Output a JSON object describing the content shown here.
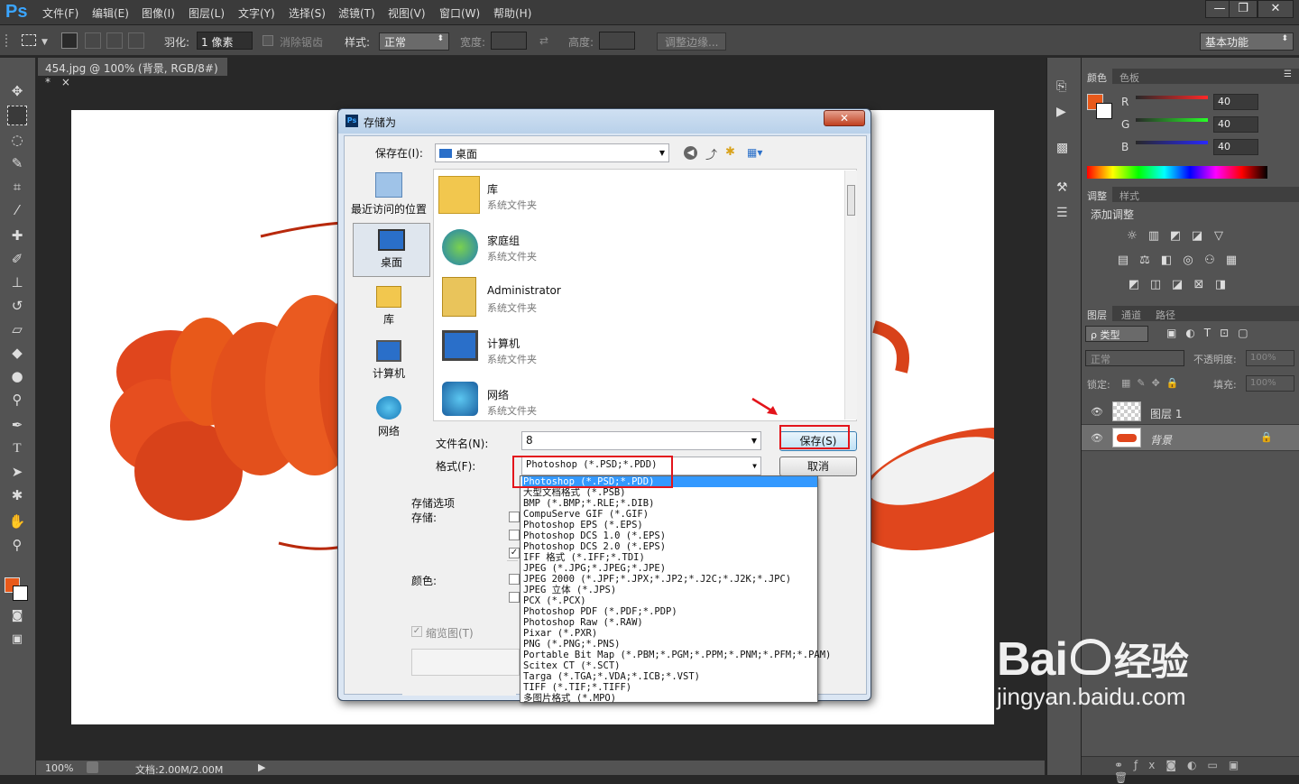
{
  "app": {
    "logo": "Ps"
  },
  "menu": [
    "文件(F)",
    "编辑(E)",
    "图像(I)",
    "图层(L)",
    "文字(Y)",
    "选择(S)",
    "滤镜(T)",
    "视图(V)",
    "窗口(W)",
    "帮助(H)"
  ],
  "window_controls": {
    "min": "—",
    "restore": "❐",
    "close": "✕"
  },
  "options": {
    "feather_label": "羽化:",
    "feather_value": "1 像素",
    "antialias_label": "消除锯齿",
    "style_label": "样式:",
    "style_value": "正常",
    "width_label": "宽度:",
    "height_label": "高度:",
    "refine_label": "调整边缘...",
    "workspace": "基本功能"
  },
  "document": {
    "tab": "454.jpg @ 100% (背景, RGB/8#) *",
    "tab_close": "×"
  },
  "status": {
    "zoom": "100%",
    "doc": "文档:2.00M/2.00M"
  },
  "colors": {
    "fg": "#e8591a",
    "bg": "#ffffff",
    "accent": "#e3141b"
  },
  "panels": {
    "color_tabs": [
      "颜色",
      "色板"
    ],
    "rgb": [
      {
        "label": "R",
        "value": "40"
      },
      {
        "label": "G",
        "value": "40"
      },
      {
        "label": "B",
        "value": "40"
      }
    ],
    "adjust_tabs": [
      "调整",
      "样式"
    ],
    "adjust_title": "添加调整",
    "layers_tabs": [
      "图层",
      "通道",
      "路径"
    ],
    "kind_label": "ρ 类型",
    "blend_mode": "正常",
    "opacity_label": "不透明度:",
    "opacity_value": "100%",
    "lock_label": "锁定:",
    "fill_label": "填充:",
    "fill_value": "100%",
    "layers": [
      {
        "name": "图层 1"
      },
      {
        "name": "背景"
      }
    ]
  },
  "dialog": {
    "title": "存储为",
    "save_in_label": "保存在(I):",
    "save_in_value": "桌面",
    "places": [
      "最近访问的位置",
      "桌面",
      "库",
      "计算机",
      "网络"
    ],
    "files": [
      {
        "name": "库",
        "type": "系统文件夹"
      },
      {
        "name": "家庭组",
        "type": "系统文件夹"
      },
      {
        "name": "Administrator",
        "type": "系统文件夹"
      },
      {
        "name": "计算机",
        "type": "系统文件夹"
      },
      {
        "name": "网络",
        "type": "系统文件夹"
      }
    ],
    "filename_label": "文件名(N):",
    "filename_value": "8",
    "format_label": "格式(F):",
    "format_value": "Photoshop (*.PSD;*.PDD)",
    "save_button": "保存(S)",
    "cancel_button": "取消",
    "options_title": "存储选项",
    "save_label": "存储:",
    "color_label": "颜色:",
    "thumbnail_label": "缩览图(T)",
    "format_options": [
      "Photoshop (*.PSD;*.PDD)",
      "大型文档格式 (*.PSB)",
      "BMP (*.BMP;*.RLE;*.DIB)",
      "CompuServe GIF (*.GIF)",
      "Photoshop EPS (*.EPS)",
      "Photoshop DCS 1.0 (*.EPS)",
      "Photoshop DCS 2.0 (*.EPS)",
      "IFF 格式 (*.IFF;*.TDI)",
      "JPEG (*.JPG;*.JPEG;*.JPE)",
      "JPEG 2000 (*.JPF;*.JPX;*.JP2;*.J2C;*.J2K;*.JPC)",
      "JPEG 立体 (*.JPS)",
      "PCX (*.PCX)",
      "Photoshop PDF (*.PDF;*.PDP)",
      "Photoshop Raw (*.RAW)",
      "Pixar (*.PXR)",
      "PNG (*.PNG;*.PNS)",
      "Portable Bit Map (*.PBM;*.PGM;*.PPM;*.PNM;*.PFM;*.PAM)",
      "Scitex CT (*.SCT)",
      "Targa (*.TGA;*.VDA;*.ICB;*.VST)",
      "TIFF (*.TIF;*.TIFF)",
      "多图片格式 (*.MPO)"
    ]
  },
  "watermark": {
    "brand": "Bai",
    "brand_suffix": "经验",
    "url": "jingyan.baidu.com"
  }
}
